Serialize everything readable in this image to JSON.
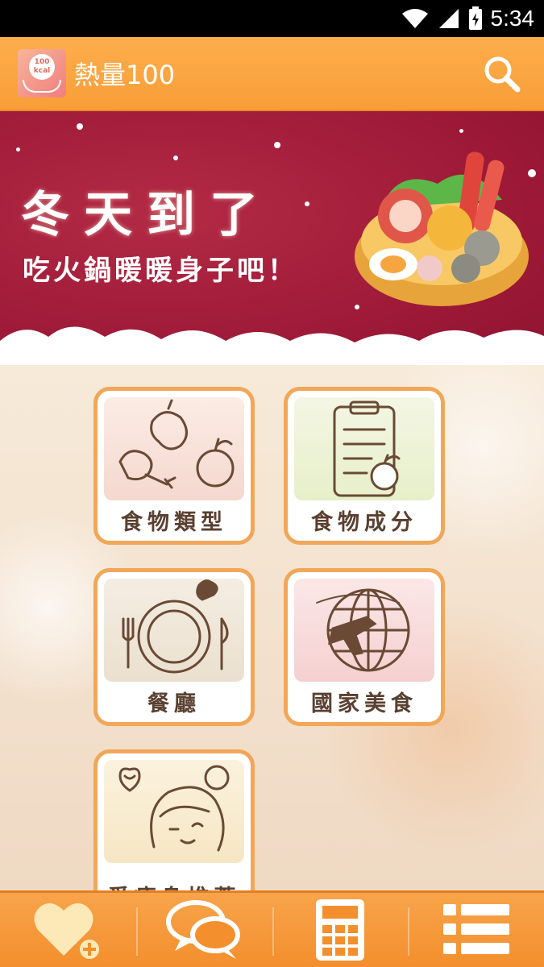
{
  "status_bar": {
    "time": "5:34",
    "icons": [
      "wifi-icon",
      "cell-signal-icon",
      "battery-charging-icon"
    ]
  },
  "app_bar": {
    "title": "熱量100",
    "logo_text": "100 kcal",
    "search_icon": "search-icon"
  },
  "banner": {
    "title": "冬天到了",
    "subtitle": "吃火鍋暖暖身子吧！",
    "colors": {
      "background": "#9b1836",
      "text": "#ffffff"
    }
  },
  "menu": {
    "tiles": [
      {
        "label": "食物類型",
        "icon": "food-types-icon"
      },
      {
        "label": "食物成分",
        "icon": "nutrition-clipboard-icon"
      },
      {
        "label": "餐廳",
        "icon": "restaurant-plate-icon"
      },
      {
        "label": "國家美食",
        "icon": "globe-plane-icon"
      },
      {
        "label": "愛瘦身推薦",
        "icon": "diet-girl-icon"
      }
    ]
  },
  "bottom_nav": {
    "items": [
      {
        "icon": "favorite-heart-plus-icon"
      },
      {
        "icon": "chat-bubbles-icon"
      },
      {
        "icon": "calculator-icon"
      },
      {
        "icon": "list-menu-icon"
      }
    ]
  },
  "colors": {
    "accent": "#f89e37",
    "tile_border": "#f1a757",
    "label_text": "#5a4030"
  }
}
